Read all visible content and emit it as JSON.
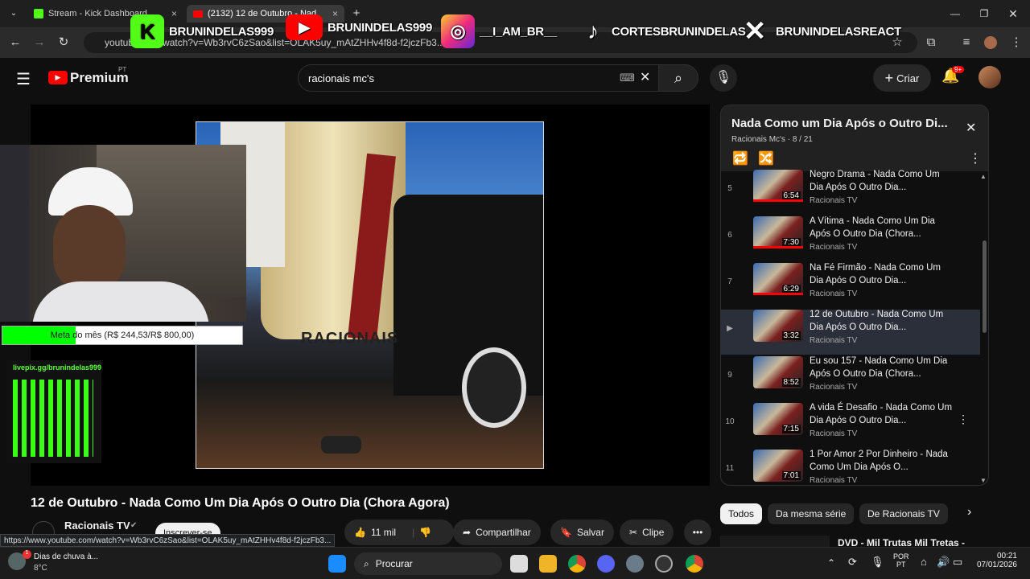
{
  "browser": {
    "tabs": [
      {
        "label": "Stream - Kick Dashboard",
        "close": "×"
      },
      {
        "label": "(2132) 12 de Outubro - Nad",
        "close": "×"
      }
    ],
    "new_tab": "+",
    "url": "youtube.com/watch?v=Wb3rvC6zSao&list=OLAK5uy_mAtZHHv4f8d-f2jczFb3...",
    "status_url": "https://www.youtube.com/watch?v=Wb3rvC6zSao&list=OLAK5uy_mAtZHHv4f8d-f2jczFb3..."
  },
  "overlay": {
    "kick_handle": "BRUNINDELAS999",
    "youtube_handle": "BRUNINDELAS999",
    "instagram_handle": "__I_AM_BR__",
    "tiktok_handle": "CORTESBRUNINDELAS",
    "x_handle": "BRUNINDELASREACT",
    "goal_text": "Meta do mês (R$ 244,53/R$ 800,00)",
    "goal_progress": 0.3057,
    "livepix_url": "livepix.gg/brunindelas999"
  },
  "youtube": {
    "logo": "Premium",
    "logo_sup": "PT",
    "search_value": "racionais mc's",
    "create_label": "Criar",
    "notif_count": "9+",
    "video_title": "12 de Outubro - Nada Como Um Dia Após O Outro Dia (Chora Agora)",
    "channel": "Racionais TV",
    "subscribe": "Inscrever-se",
    "likes": "11 mil",
    "share": "Compartilhar",
    "save": "Salvar",
    "clip": "Clipe",
    "album_label": "RACIONAIS"
  },
  "playlist": {
    "title": "Nada Como um Dia Após o Outro Di...",
    "meta": "Racionais Mc's · 8 / 21",
    "items": [
      {
        "num": "5",
        "title": "Negro Drama - Nada Como Um Dia Após O Outro Dia...",
        "channel": "Racionais TV",
        "duration": "6:54"
      },
      {
        "num": "6",
        "title": "A Vítima - Nada Como Um Dia Após O Outro Dia (Chora...",
        "channel": "Racionais TV",
        "duration": "7:30"
      },
      {
        "num": "7",
        "title": "Na Fé Firmão - Nada Como Um Dia Após O Outro Dia...",
        "channel": "Racionais TV",
        "duration": "6:29"
      },
      {
        "num": "▶",
        "title": "12 de Outubro - Nada Como Um Dia Após O Outro Dia...",
        "channel": "Racionais TV",
        "duration": "3:32"
      },
      {
        "num": "9",
        "title": "Eu sou 157 - Nada Como Um Dia Após O Outro Dia (Chora...",
        "channel": "Racionais TV",
        "duration": "8:52"
      },
      {
        "num": "10",
        "title": "A vida É Desafio - Nada Como Um Dia Após O Outro Dia...",
        "channel": "Racionais TV",
        "duration": "7:15"
      },
      {
        "num": "11",
        "title": "1 Por Amor 2 Por Dinheiro - Nada Como Um Dia Após O...",
        "channel": "Racionais TV",
        "duration": "7:01"
      }
    ],
    "chips": [
      "Todos",
      "Da mesma série",
      "De Racionais TV"
    ],
    "next_video": "DVD - Mil Trutas Mil Tretas -"
  },
  "taskbar": {
    "weather_title": "Dias de chuva à...",
    "weather_temp": "8°C",
    "search_label": "Procurar",
    "lang": "POR",
    "lang2": "PT",
    "time": "00:21",
    "date": "07/01/2026"
  }
}
